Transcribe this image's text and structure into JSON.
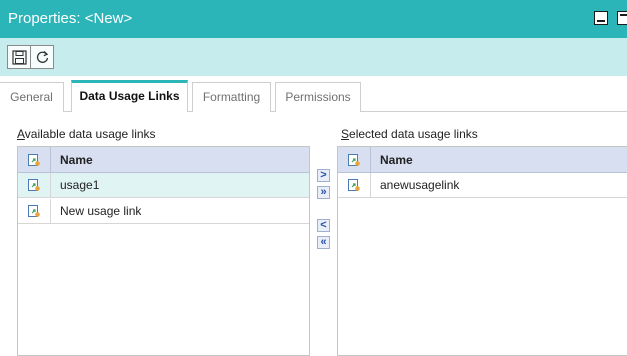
{
  "window": {
    "title": "Properties: <New>"
  },
  "toolbar": {
    "save_icon": "floppy-disk-icon",
    "refresh_icon": "refresh-icon"
  },
  "tabs": [
    {
      "label": "General",
      "active": false
    },
    {
      "label": "Data Usage Links",
      "active": true
    },
    {
      "label": "Formatting",
      "active": false
    },
    {
      "label": "Permissions",
      "active": false
    }
  ],
  "available": {
    "label": "Available data usage links",
    "column_header": "Name",
    "rows": [
      {
        "name": "usage1",
        "selected": true
      },
      {
        "name": "New usage link",
        "selected": false
      }
    ]
  },
  "selected": {
    "label": "Selected data usage links",
    "column_header": "Name",
    "rows": [
      {
        "name": "anewusagelink",
        "selected": false
      }
    ]
  },
  "transfer": {
    "add_one": ">",
    "add_all": "»",
    "remove_one": "<",
    "remove_all": "«"
  },
  "colors": {
    "accent": "#2cb5b9",
    "toolbar_bg": "#c6ecee",
    "grid_header_bg": "#d8dff1",
    "selected_row_bg": "#dff4f3"
  }
}
